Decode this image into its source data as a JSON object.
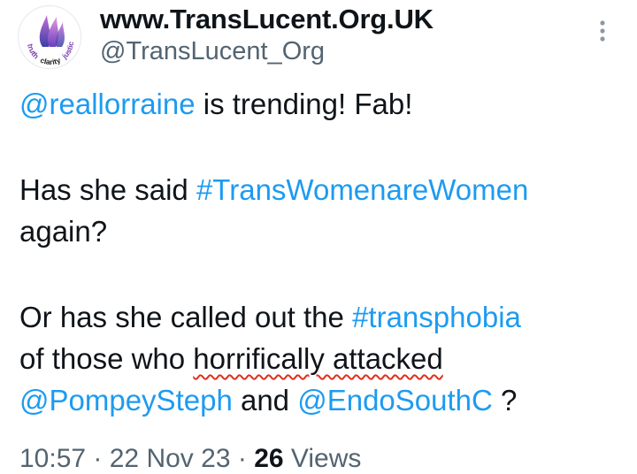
{
  "author": {
    "display_name": "www.TransLucent.Org.UK",
    "handle": "@TransLucent_Org",
    "logo_words": [
      "truth",
      "clarity",
      "justice"
    ]
  },
  "tweet": {
    "line1": {
      "mention": "@reallorraine",
      "text": " is trending! Fab!"
    },
    "line2": {
      "text_a": "Has she said ",
      "hashtag": "#TransWomenareWomen",
      "text_b": "again?"
    },
    "line3": {
      "text_a": "Or has she called out the ",
      "hashtag": "#transphobia",
      "text_b": "of those who ",
      "misspelled": "horrifically attacked",
      "mention_a": "@PompeySteph",
      "text_c": " and ",
      "mention_b": "@EndoSouthC",
      "text_d": " ?"
    }
  },
  "meta": {
    "time": "10:57",
    "sep1": " · ",
    "date": "22 Nov 23",
    "sep2": " · ",
    "views_count": "26",
    "views_label": " Views"
  },
  "colors": {
    "link": "#1d9bf0",
    "text": "#0f1419",
    "muted": "#536471",
    "spellcheck": "#e0301e"
  },
  "icons": {
    "more": "vertical-ellipsis"
  }
}
